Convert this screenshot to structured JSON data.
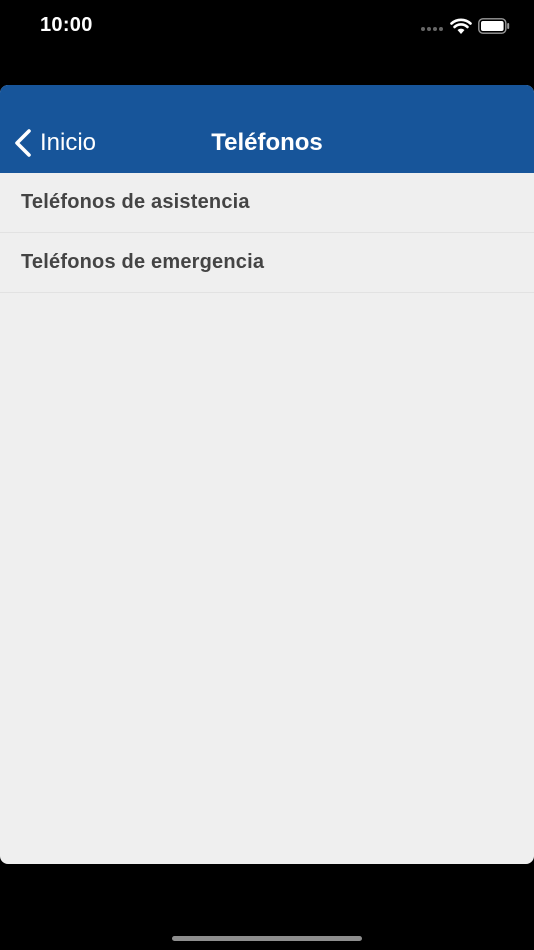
{
  "status_bar": {
    "time": "10:00"
  },
  "nav": {
    "back_label": "Inicio",
    "title": "Teléfonos"
  },
  "list": {
    "items": [
      {
        "label": "Teléfonos de asistencia"
      },
      {
        "label": "Teléfonos de emergencia"
      }
    ]
  },
  "colors": {
    "nav_background": "#17559a",
    "list_background": "#efefef",
    "item_text": "#444444"
  },
  "icons": [
    "chevron-left-icon",
    "wifi-icon",
    "battery-icon"
  ]
}
